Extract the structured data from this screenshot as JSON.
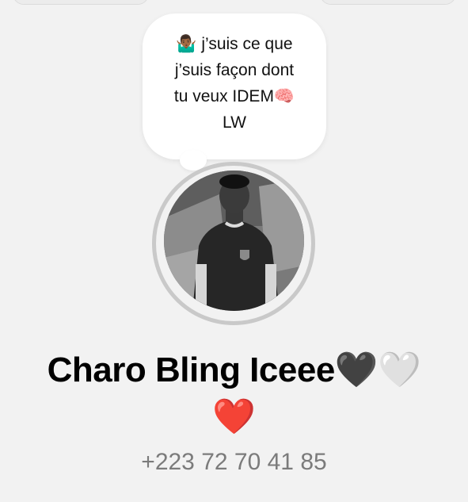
{
  "status": {
    "lines": [
      "🤷🏾‍♂️ j’suis ce que",
      "j’suis façon dont",
      "tu veux IDEM🧠",
      "LW"
    ]
  },
  "avatar": {
    "icon": "profile-photo"
  },
  "contact": {
    "name_line1": "Charo Bling Iceee🖤🤍",
    "name_line2": "❤️",
    "phone": "+223 72 70 41 85"
  },
  "colors": {
    "background": "#f2f2f2",
    "bubble": "#ffffff",
    "name": "#000000",
    "phone": "#7b7b7b",
    "avatar_ring": "#c9c9c9"
  }
}
